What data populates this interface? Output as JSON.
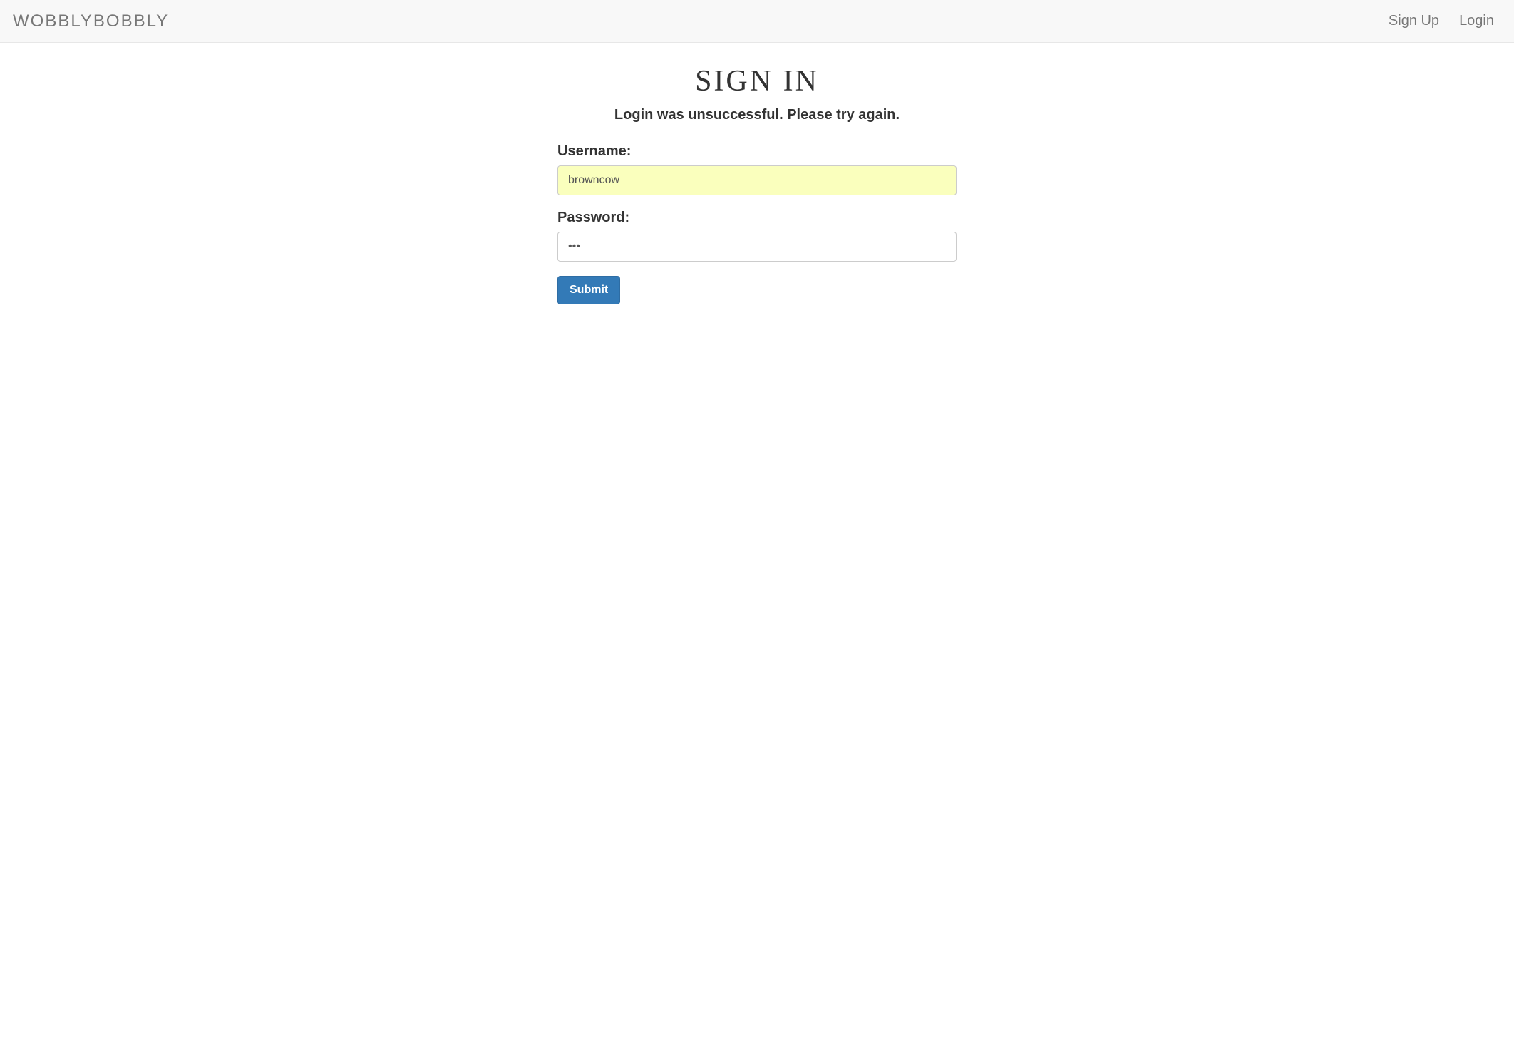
{
  "navbar": {
    "brand": "WOBBLYBOBBLY",
    "links": {
      "signup": "Sign Up",
      "login": "Login"
    }
  },
  "page": {
    "title_word1": "SIGN",
    "title_word2": "IN",
    "alert": "Login was unsuccessful. Please try again."
  },
  "form": {
    "username": {
      "label": "Username:",
      "value": "browncow"
    },
    "password": {
      "label": "Password:",
      "value": "•••"
    },
    "submit_label": "Submit"
  }
}
